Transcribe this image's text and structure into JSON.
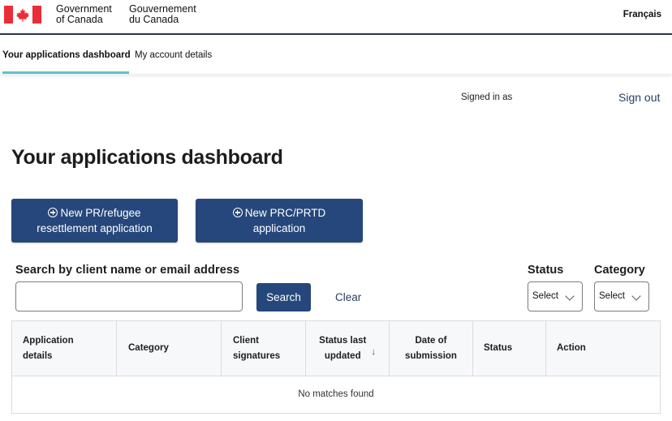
{
  "header": {
    "wordmark_en_line1": "Government",
    "wordmark_en_line2": "of Canada",
    "wordmark_fr_line1": "Gouvernement",
    "wordmark_fr_line2": "du Canada",
    "language_toggle": "Français",
    "flag_icon": "canada-flag-icon"
  },
  "tabs": [
    {
      "label": "Your applications dashboard",
      "active": true
    },
    {
      "label": "My account details",
      "active": false
    }
  ],
  "session": {
    "signed_in_text": "Signed in as",
    "sign_out_label": "Sign out"
  },
  "page_title": "Your applications dashboard",
  "actions": {
    "new_pr_line1": "New PR/refugee",
    "new_pr_line2": "resettlement application",
    "new_prc_line1": "New PRC/PRTD",
    "new_prc_line2": "application",
    "icon": "plus-circle-icon"
  },
  "search": {
    "label": "Search by client name or email address",
    "value": "",
    "button_label": "Search",
    "clear_label": "Clear"
  },
  "filters": {
    "status_label": "Status",
    "status_value": "Select",
    "category_label": "Category",
    "category_value": "Select"
  },
  "table": {
    "columns": [
      {
        "line1": "Application",
        "line2": "details"
      },
      {
        "line1": "Category",
        "line2": ""
      },
      {
        "line1": "Client",
        "line2": "signatures"
      },
      {
        "line1": "Status last",
        "line2": "updated"
      },
      {
        "line1": "Date of",
        "line2": "submission"
      },
      {
        "line1": "Status",
        "line2": ""
      },
      {
        "line1": "Action",
        "line2": ""
      }
    ],
    "sort_icon": "arrow-down-icon",
    "empty_message": "No matches found"
  },
  "colors": {
    "primary_button": "#26477b",
    "link": "#284162",
    "tab_underline": "#59c6c9",
    "header_rule": "#26374a",
    "flag_red": "#eb2d37"
  }
}
